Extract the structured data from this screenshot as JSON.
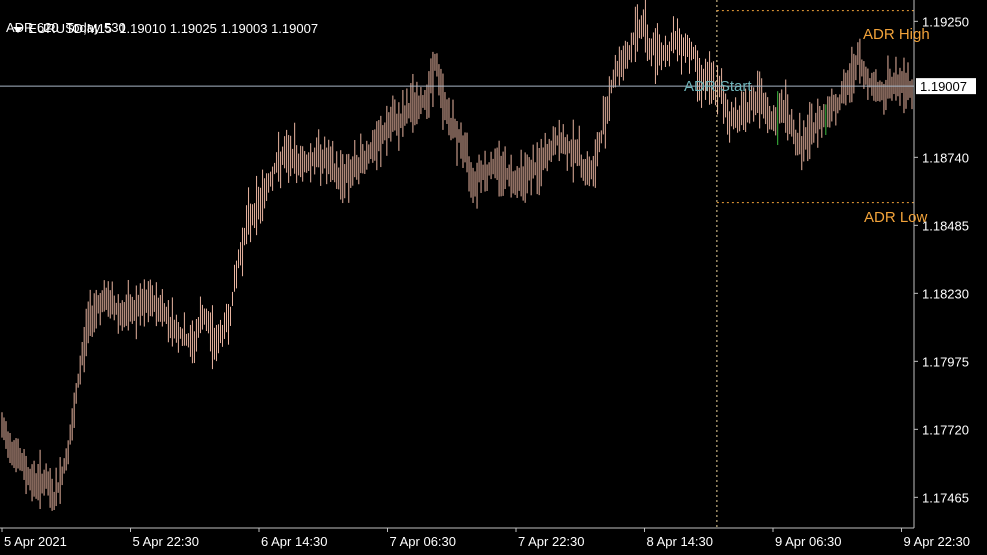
{
  "header": {
    "symbol_line": "EURUSD,M15  1.19010 1.19025 1.19003 1.19007",
    "adr_line": "ADR 620  Today 530"
  },
  "labels": {
    "adr_high": "ADR High",
    "adr_low": "ADR Low",
    "adr_start": "ADR Start",
    "current_price": "1.19007"
  },
  "colors": {
    "background": "#000000",
    "candle": "#e8b4a0",
    "candle_up": "#3cc040",
    "adr_level": "#f2a33a",
    "adr_start": "#6fb3b8",
    "price_line": "#a9b7c6",
    "axis": "#c0c0c0"
  },
  "chart_data": {
    "type": "line",
    "title": "EURUSD,M15",
    "y_ticks": [
      "1.19250",
      "1.18740",
      "1.18485",
      "1.18230",
      "1.17975",
      "1.17720",
      "1.17465"
    ],
    "x_ticks": [
      "5 Apr 2021",
      "5 Apr 22:30",
      "6 Apr 14:30",
      "7 Apr 06:30",
      "7 Apr 22:30",
      "8 Apr 14:30",
      "9 Apr 06:30",
      "9 Apr 22:30"
    ],
    "ylim": [
      1.1735,
      1.1933
    ],
    "last_price": 1.19007,
    "adr_high": 1.1929,
    "adr_low": 1.1857,
    "adr_start_x": 0.7856,
    "series": [
      {
        "x": [
          0.0,
          0.02,
          0.034,
          0.046,
          0.058,
          0.07,
          0.078,
          0.085,
          0.095,
          0.104,
          0.118,
          0.132,
          0.15,
          0.164,
          0.176,
          0.19,
          0.21,
          0.22,
          0.236,
          0.25,
          0.26,
          0.27,
          0.28,
          0.29,
          0.3,
          0.31,
          0.32,
          0.33,
          0.34,
          0.35,
          0.36,
          0.37,
          0.38,
          0.39,
          0.4,
          0.41,
          0.42,
          0.43,
          0.44,
          0.45,
          0.46,
          0.47,
          0.476,
          0.485,
          0.495,
          0.505,
          0.515,
          0.52,
          0.525,
          0.532,
          0.54,
          0.55,
          0.56,
          0.575,
          0.59,
          0.6,
          0.61,
          0.62,
          0.63,
          0.64,
          0.65,
          0.66,
          0.67,
          0.68,
          0.69,
          0.695,
          0.705,
          0.712,
          0.72,
          0.73,
          0.74,
          0.75,
          0.76,
          0.765,
          0.775,
          0.79,
          0.8,
          0.81,
          0.82,
          0.83,
          0.84,
          0.845,
          0.855,
          0.86,
          0.87,
          0.88,
          0.89,
          0.9,
          0.91,
          0.92,
          0.928,
          0.934,
          0.94,
          0.95,
          0.96,
          0.965,
          0.975,
          0.99,
          1.0
        ],
        "y": [
          1.1772,
          1.176,
          1.1752,
          1.1753,
          1.1746,
          1.176,
          1.1774,
          1.1793,
          1.1813,
          1.1819,
          1.182,
          1.1815,
          1.1817,
          1.182,
          1.1817,
          1.181,
          1.1803,
          1.1815,
          1.1804,
          1.1814,
          1.1835,
          1.185,
          1.1855,
          1.1862,
          1.187,
          1.1874,
          1.1874,
          1.1872,
          1.1873,
          1.1875,
          1.1871,
          1.1867,
          1.1868,
          1.187,
          1.1875,
          1.1877,
          1.1883,
          1.1887,
          1.1888,
          1.1894,
          1.1893,
          1.19,
          1.191,
          1.1895,
          1.1885,
          1.188,
          1.1868,
          1.1865,
          1.187,
          1.1868,
          1.1871,
          1.187,
          1.1866,
          1.1868,
          1.187,
          1.1875,
          1.188,
          1.1878,
          1.1877,
          1.187,
          1.1868,
          1.1885,
          1.1902,
          1.191,
          1.1913,
          1.192,
          1.1925,
          1.1914,
          1.1915,
          1.1913,
          1.1918,
          1.1916,
          1.1913,
          1.1905,
          1.1903,
          1.1898,
          1.1888,
          1.189,
          1.1893,
          1.1896,
          1.1891,
          1.1887,
          1.189,
          1.1894,
          1.1882,
          1.1878,
          1.1884,
          1.1888,
          1.1893,
          1.1895,
          1.1899,
          1.1905,
          1.1911,
          1.1903,
          1.1901,
          1.1897,
          1.1901,
          1.1901,
          1.19
        ]
      }
    ]
  }
}
